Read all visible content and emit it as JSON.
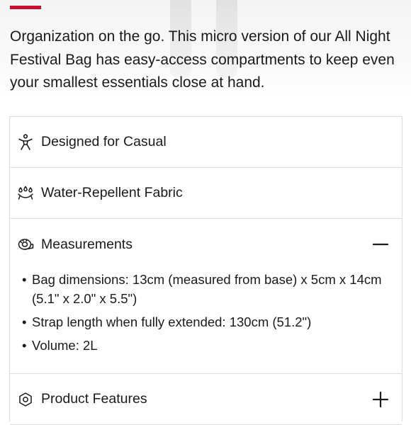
{
  "product": {
    "description": "Organization on the go. This micro version of our All Night Festival Bag has easy-access compartments to keep even your smallest essentials close at hand."
  },
  "accordion": {
    "items": [
      {
        "label": "Designed for Casual",
        "icon": "person-casual-icon"
      },
      {
        "label": "Water-Repellent Fabric",
        "icon": "water-drops-icon"
      },
      {
        "label": "Measurements",
        "icon": "tape-measure-icon",
        "expanded": true,
        "details": [
          "Bag dimensions: 13cm (measured from base) x 5cm x 14cm (5.1\" x 2.0\" x 5.5\")",
          "Strap length when fully extended: 130cm (51.2\")",
          "Volume: 2L"
        ]
      },
      {
        "label": "Product Features",
        "icon": "features-icon",
        "expanded": false
      }
    ]
  },
  "colors": {
    "accent": "#c8102e",
    "border": "#dcdcdc",
    "text": "#1a1a1a"
  }
}
